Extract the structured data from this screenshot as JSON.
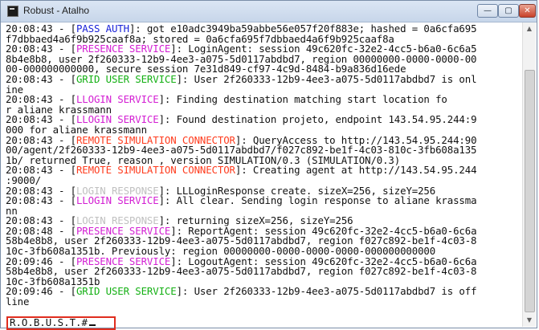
{
  "window": {
    "title": "Robust - Atalho",
    "minimize_label": "—",
    "maximize_label": "▢",
    "close_label": "✕",
    "icon": "console-app-icon"
  },
  "console": {
    "lines": [
      [
        {
          "t": "20:08:43 - ["
        },
        {
          "t": "PASS AUTH",
          "c": "blue"
        },
        {
          "t": "]: got e10adc3949ba59abbe56e057f20f883e; hashed = 0a6cfa695"
        }
      ],
      [
        {
          "t": "f7dbbaed4a6f9b925caaf8a; stored = 0a6cfa695f7dbbaed4a6f9b925caaf8a"
        }
      ],
      [
        {
          "t": "20:08:43 - ["
        },
        {
          "t": "PRESENCE SERVICE",
          "c": "magenta"
        },
        {
          "t": "]: LoginAgent: session 49c620fc-32e2-4cc5-b6a0-6c6a5"
        }
      ],
      [
        {
          "t": "8b4e8b8, user 2f260333-12b9-4ee3-a075-5d0117abdbd7, region 00000000-0000-0000-00"
        }
      ],
      [
        {
          "t": "00-000000000000, secure session 7e31d849-cf97-4c9d-8484-b9a836d16ede"
        }
      ],
      [
        {
          "t": "20:08:43 - ["
        },
        {
          "t": "GRID USER SERVICE",
          "c": "green"
        },
        {
          "t": "]: User 2f260333-12b9-4ee3-a075-5d0117abdbd7 is onl"
        }
      ],
      [
        {
          "t": "ine"
        }
      ],
      [
        {
          "t": "20:08:43 - ["
        },
        {
          "t": "LLOGIN SERVICE",
          "c": "magenta"
        },
        {
          "t": "]: Finding destination matching start location fo"
        }
      ],
      [
        {
          "t": "r aliane krassmann"
        }
      ],
      [
        {
          "t": "20:08:43 - ["
        },
        {
          "t": "LLOGIN SERVICE",
          "c": "magenta"
        },
        {
          "t": "]: Found destination projeto, endpoint 143.54.95.244:9"
        }
      ],
      [
        {
          "t": "000 for aliane krassmann"
        }
      ],
      [
        {
          "t": "20:08:43 - ["
        },
        {
          "t": "REMOTE SIMULATION CONNECTOR",
          "c": "orange"
        },
        {
          "t": "]: QueryAccess to http://143.54.95.244:90"
        }
      ],
      [
        {
          "t": "00/agent/2f260333-12b9-4ee3-a075-5d0117abdbd7/f027c892-be1f-4c03-810c-3fb608a135"
        }
      ],
      [
        {
          "t": "1b/ returned True, reason , version SIMULATION/0.3 (SIMULATION/0.3)"
        }
      ],
      [
        {
          "t": "20:08:43 - ["
        },
        {
          "t": "REMOTE SIMULATION CONNECTOR",
          "c": "orange"
        },
        {
          "t": "]: Creating agent at http://143.54.95.244"
        }
      ],
      [
        {
          "t": ":9000/"
        }
      ],
      [
        {
          "t": "20:08:43 - ["
        },
        {
          "t": "LOGIN RESPONSE",
          "c": "gray"
        },
        {
          "t": "]: LLLoginResponse create. sizeX=256, sizeY=256"
        }
      ],
      [
        {
          "t": "20:08:43 - ["
        },
        {
          "t": "LLOGIN SERVICE",
          "c": "magenta"
        },
        {
          "t": "]: All clear. Sending login response to aliane krassma"
        }
      ],
      [
        {
          "t": "nn"
        }
      ],
      [
        {
          "t": "20:08:43 - ["
        },
        {
          "t": "LOGIN RESPONSE",
          "c": "gray"
        },
        {
          "t": "]: returning sizeX=256, sizeY=256"
        }
      ],
      [
        {
          "t": "20:08:48 - ["
        },
        {
          "t": "PRESENCE SERVICE",
          "c": "magenta"
        },
        {
          "t": "]: ReportAgent: session 49c620fc-32e2-4cc5-b6a0-6c6a"
        }
      ],
      [
        {
          "t": "58b4e8b8, user 2f260333-12b9-4ee3-a075-5d0117abdbd7, region f027c892-be1f-4c03-8"
        }
      ],
      [
        {
          "t": "10c-3fb608a1351b. Previously: region 00000000-0000-0000-0000-000000000000"
        }
      ],
      [
        {
          "t": "20:09:46 - ["
        },
        {
          "t": "PRESENCE SERVICE",
          "c": "magenta"
        },
        {
          "t": "]: LogoutAgent: session 49c620fc-32e2-4cc5-b6a0-6c6a"
        }
      ],
      [
        {
          "t": "58b4e8b8, user 2f260333-12b9-4ee3-a075-5d0117abdbd7, region f027c892-be1f-4c03-8"
        }
      ],
      [
        {
          "t": "10c-3fb608a1351b"
        }
      ],
      [
        {
          "t": "20:09:46 - ["
        },
        {
          "t": "GRID USER SERVICE",
          "c": "green"
        },
        {
          "t": "]: User 2f260333-12b9-4ee3-a075-5d0117abdbd7 is off"
        }
      ],
      [
        {
          "t": "line"
        }
      ]
    ],
    "prompt": "R.O.B.U.S.T.#"
  },
  "colors": {
    "blue": "#1a22d8",
    "magenta": "#d31fd3",
    "green": "#14b014",
    "orange": "#ff3c1e",
    "gray": "#c0c0c0",
    "highlight_box": "#e02d1e"
  }
}
